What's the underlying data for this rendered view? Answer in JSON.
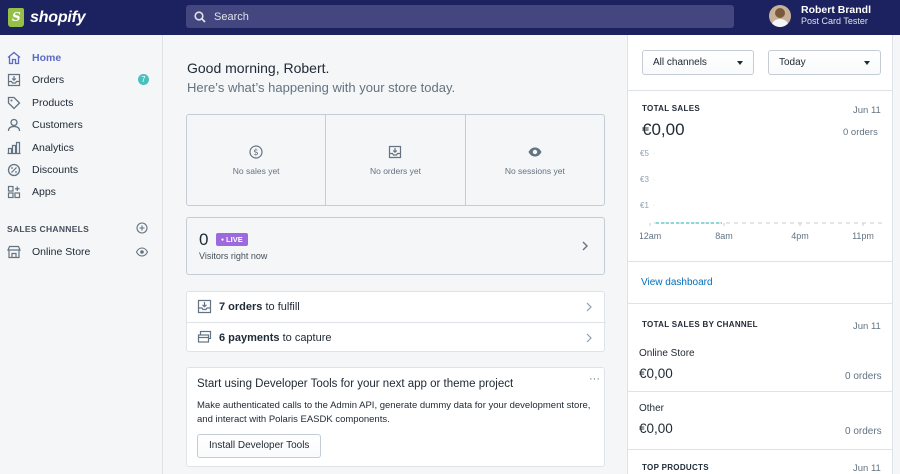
{
  "topbar": {
    "logo_text": "shopify",
    "search_placeholder": "Search",
    "user_name": "Robert Brandl",
    "store_name": "Post Card Tester"
  },
  "sidebar": {
    "items": [
      {
        "label": "Home",
        "icon": "home-icon",
        "active": true
      },
      {
        "label": "Orders",
        "icon": "orders-icon",
        "badge": "7"
      },
      {
        "label": "Products",
        "icon": "tag-icon"
      },
      {
        "label": "Customers",
        "icon": "person-icon"
      },
      {
        "label": "Analytics",
        "icon": "bar-chart-icon"
      },
      {
        "label": "Discounts",
        "icon": "discount-icon"
      },
      {
        "label": "Apps",
        "icon": "apps-icon"
      }
    ],
    "sales_channels_title": "SALES CHANNELS",
    "channels": [
      {
        "label": "Online Store",
        "icon": "store-icon"
      }
    ]
  },
  "main": {
    "greeting": "Good morning, Robert.",
    "subtitle": "Here’s what’s happening with your store today.",
    "stats": [
      {
        "label": "No sales yet",
        "icon": "dollar-icon"
      },
      {
        "label": "No orders yet",
        "icon": "inbox-icon"
      },
      {
        "label": "No sessions yet",
        "icon": "eye-icon"
      }
    ],
    "live": {
      "count": "0",
      "badge": "LIVE",
      "subtitle": "Visitors right now"
    },
    "tasks": [
      {
        "bold": "7 orders",
        "rest": " to fulfill",
        "icon": "fulfill-icon"
      },
      {
        "bold": "6 payments",
        "rest": " to capture",
        "icon": "payment-icon"
      }
    ],
    "dev_card": {
      "title": "Start using Developer Tools for your next app or theme project",
      "menu": "···",
      "body": "Make authenticated calls to the Admin API, generate dummy data for your development store, and interact with Polaris EASDK components.",
      "button": "Install Developer Tools"
    }
  },
  "right": {
    "channel_select": "All channels",
    "date_select": "Today",
    "total_sales": {
      "title": "TOTAL SALES",
      "date": "Jun 11",
      "value": "€0,00",
      "orders": "0 orders"
    },
    "chart_data": {
      "type": "line",
      "x": [
        "12am",
        "8am",
        "4pm",
        "11pm"
      ],
      "y_ticks": [
        "€5",
        "€3",
        "€1"
      ],
      "series": [
        {
          "values": [
            0,
            0,
            0,
            0,
            0,
            0,
            0,
            0,
            0,
            0,
            0,
            0
          ]
        }
      ],
      "accent": "#47c1bf"
    },
    "view_dashboard": "View dashboard",
    "by_channel": {
      "title": "TOTAL SALES BY CHANNEL",
      "date": "Jun 11",
      "channels": [
        {
          "name": "Online Store",
          "value": "€0,00",
          "orders": "0 orders"
        },
        {
          "name": "Other",
          "value": "€0,00",
          "orders": "0 orders"
        }
      ]
    },
    "top_products": {
      "title": "TOP PRODUCTS",
      "date": "Jun 11"
    }
  }
}
